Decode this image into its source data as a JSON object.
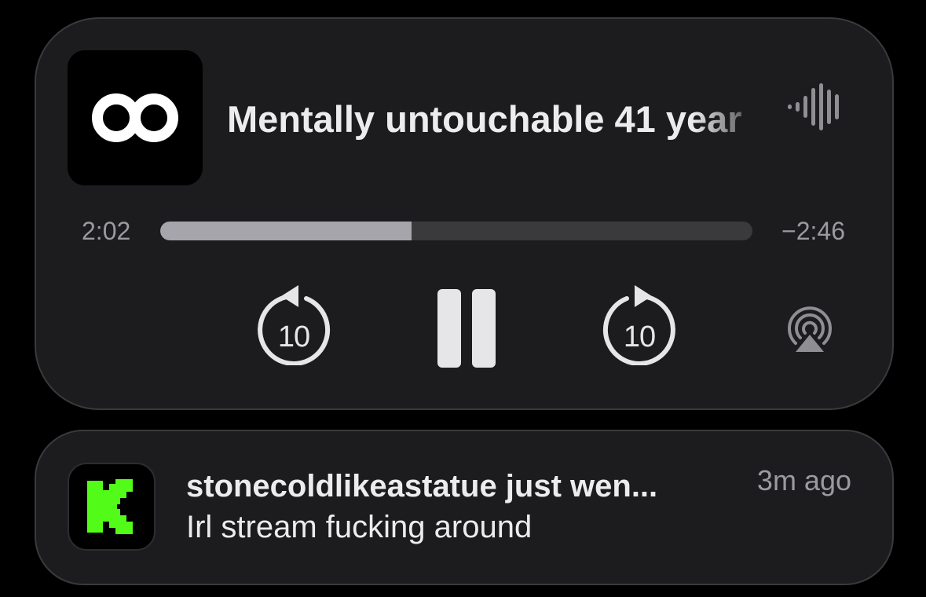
{
  "player": {
    "app_icon": "infinity-icon",
    "track_title": "Mentally untouchable 41 year",
    "playing_indicator": "waveform-icon",
    "elapsed": "2:02",
    "remaining": "−2:46",
    "progress_fraction": 0.424,
    "skip_back_label": "10",
    "skip_forward_label": "10",
    "controls": [
      "skip-back-10-icon",
      "pause-icon",
      "skip-forward-10-icon",
      "airplay-icon"
    ]
  },
  "notification": {
    "app_icon": "kick-icon",
    "title": "stonecoldlikeastatue just wen...",
    "body": "Irl stream fucking around",
    "time": "3m ago"
  },
  "colors": {
    "background": "#000000",
    "card": "#1c1c1e",
    "progress_fill": "#a6a5ab",
    "progress_track": "#3a3a3c",
    "kick_green": "#53fc18"
  }
}
